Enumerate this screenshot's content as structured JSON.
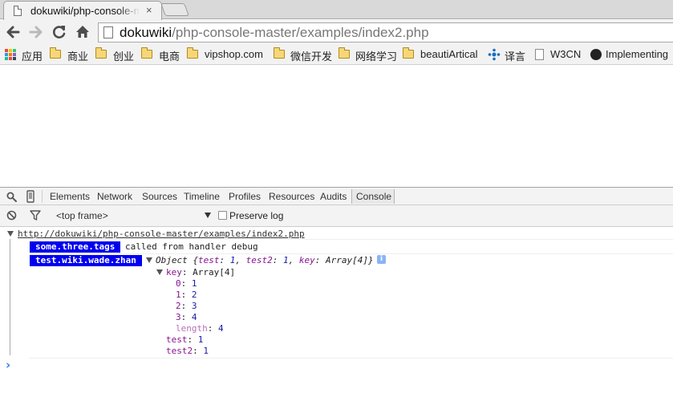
{
  "tab": {
    "title": "dokuwiki/php-console-master/examples/index2.php",
    "close_glyph": "×"
  },
  "address": {
    "host": "dokuwiki",
    "path": "/php-console-master/examples/index2.php"
  },
  "bookmarks": [
    {
      "label": "应用",
      "icon": "apps-grid-icon"
    },
    {
      "label": "商业",
      "icon": "folder-icon"
    },
    {
      "label": "创业",
      "icon": "folder-icon"
    },
    {
      "label": "电商",
      "icon": "folder-icon"
    },
    {
      "label": "vipshop.com",
      "icon": "folder-icon"
    },
    {
      "label": "微信开发",
      "icon": "folder-icon"
    },
    {
      "label": "网络学习",
      "icon": "folder-icon"
    },
    {
      "label": "beautiArtical",
      "icon": "folder-icon"
    },
    {
      "label": "译言",
      "icon": "yeeyan-icon"
    },
    {
      "label": "W3CN",
      "icon": "page-icon"
    },
    {
      "label": "Implementing",
      "icon": "site-icon"
    }
  ],
  "devtools": {
    "tabs": [
      "Elements",
      "Network",
      "Sources",
      "Timeline",
      "Profiles",
      "Resources",
      "Audits",
      "Console"
    ],
    "active_tab": "Console",
    "frame_selector": "<top frame>",
    "preserve_log_label": "Preserve log",
    "preserve_log_checked": false
  },
  "console": {
    "group_url": "http://dokuwiki/php-console-master/examples/index2.php",
    "messages": [
      {
        "tag": "some.three.tags",
        "text": "called from handler debug"
      },
      {
        "tag": "test.wiki.wade.zhan",
        "object_preview": {
          "prefix": "Object ",
          "open": "{",
          "k1": "test",
          "v1": "1",
          "k2": "test2",
          "v2": "1",
          "k3": "key",
          "v3": "Array[4]",
          "close": "}"
        }
      }
    ],
    "tree": {
      "key_label": "key",
      "key_type": "Array[4]",
      "array_items": [
        {
          "index": "0",
          "value": "1"
        },
        {
          "index": "1",
          "value": "2"
        },
        {
          "index": "2",
          "value": "3"
        },
        {
          "index": "3",
          "value": "4"
        }
      ],
      "length_label": "length",
      "length_value": "4",
      "props": [
        {
          "name": "test",
          "value": "1"
        },
        {
          "name": "test2",
          "value": "1"
        }
      ]
    },
    "prompt_glyph": "›"
  },
  "colors": {
    "tag_bg": "#0000ee",
    "key_purple": "#881391",
    "num_blue": "#1a1aa6",
    "prompt_blue": "#367cf1"
  }
}
